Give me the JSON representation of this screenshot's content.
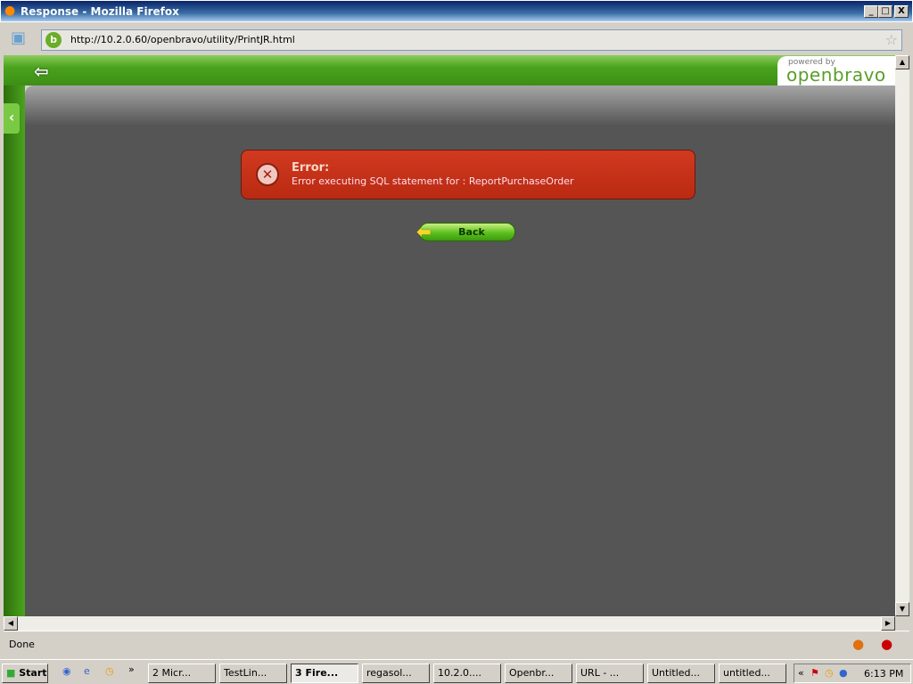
{
  "window": {
    "title": "Response - Mozilla Firefox",
    "minimize": "_",
    "maximize": "□",
    "close": "X"
  },
  "browser": {
    "url": "http://10.2.0.60/openbravo/utility/PrintJR.html",
    "status": "Done"
  },
  "app": {
    "logo_small": "powered by",
    "logo_big": "openbravo"
  },
  "error": {
    "title": "Error:",
    "message": "Error executing SQL statement for : ReportPurchaseOrder"
  },
  "back_button": "Back",
  "taskbar": {
    "start": "Start",
    "tasks": [
      "2 Micr...",
      "TestLin...",
      "3 Fire...",
      "regasol...",
      "10.2.0....",
      "Openbr...",
      "URL - ...",
      "Untitled...",
      "untitled..."
    ],
    "clock": "6:13 PM"
  }
}
